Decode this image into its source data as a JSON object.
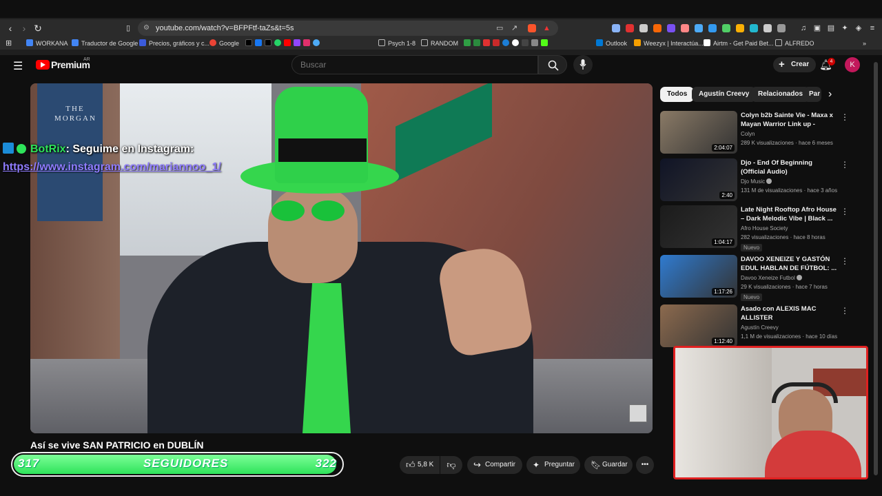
{
  "browser": {
    "url": "youtube.com/watch?v=BFPFtf-taZs&t=5s",
    "bookmarks": [
      {
        "label": "WORKANA",
        "color": "#4285f4"
      },
      {
        "label": "Traductor de Google",
        "color": "#4285f4"
      },
      {
        "label": "Precios, gráficos y c...",
        "color": "#3b5bdb"
      },
      {
        "label": "Google",
        "color": "#ea4335"
      },
      {
        "label": "Psych 1-8",
        "color": "#9aa0a6"
      },
      {
        "label": "RANDOM",
        "color": "#9aa0a6"
      },
      {
        "label": "Outlook",
        "color": "#0078d4"
      },
      {
        "label": "Weezyx | Interactúa...",
        "color": "#f59f00"
      },
      {
        "label": "Airtm - Get Paid Bet...",
        "color": "#ffffff"
      },
      {
        "label": "ALFREDO",
        "color": "#9aa0a6"
      }
    ]
  },
  "youtube": {
    "logo_text": "Premium",
    "logo_region": "AR",
    "search_placeholder": "Buscar",
    "create_label": "Crear",
    "notif_count": "4",
    "avatar_letter": "K",
    "accent": "#ff0000"
  },
  "overlay": {
    "bot_name": "BotRix",
    "bot_message": ": Seguime en Instagram:",
    "bot_link": "https://www.instagram.com/mariannoo_1/",
    "sign_text": "THE MORGAN"
  },
  "video": {
    "title": "Así se vive SAN PATRICIO en DUBLÍN",
    "likes": "5,8 K",
    "share_label": "Compartir",
    "ask_label": "Preguntar",
    "save_label": "Guardar"
  },
  "followers": {
    "current": "317",
    "label": "SEGUIDORES",
    "goal": "322",
    "progress": 0.985,
    "color": "#2ee35a"
  },
  "chips": [
    "Todos",
    "Agustín Creevy",
    "Relacionados",
    "Par"
  ],
  "recommendations": [
    {
      "title": "Colyn b2b Sainte Vie - Maxa x Mayan Warrior Link up - Burni...",
      "channel": "Colyn",
      "meta": "289 K visualizaciones · hace 6 meses",
      "duration": "2:04:07",
      "badge": "",
      "thumb": "#8a7a66",
      "verified": false
    },
    {
      "title": "Djo - End Of Beginning (Official Audio)",
      "channel": "Djo Music",
      "meta": "131 M de visualizaciones · hace 3 años",
      "duration": "2:40",
      "badge": "",
      "thumb": "#101426",
      "verified": true
    },
    {
      "title": "Late Night Rooftop Afro House – Dark Melodic Vibe | Black ...",
      "channel": "Afro House Society",
      "meta": "282 visualizaciones · hace 8 horas",
      "duration": "1:04:17",
      "badge": "Nuevo",
      "thumb": "#1b1b1b",
      "verified": false
    },
    {
      "title": "DAVOO XENEIZE Y GASTÓN EDUL HABLAN DE FÚTBOL: ...",
      "channel": "Davoo Xeneize Futbol",
      "meta": "29 K visualizaciones · hace 7 horas",
      "duration": "1:17:26",
      "badge": "Nuevo",
      "thumb": "#2f7bd0",
      "verified": true
    },
    {
      "title": "Asado con ALEXIS MAC ALLISTER",
      "channel": "Agustín Creevy",
      "meta": "1,1 M de visualizaciones · hace 10 días",
      "duration": "1:12:40",
      "badge": "",
      "thumb": "#8c6a4e",
      "verified": false
    }
  ]
}
